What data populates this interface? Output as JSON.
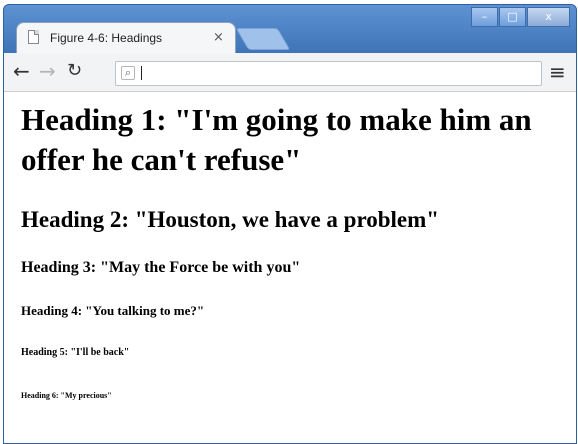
{
  "browser": {
    "tab_title": "Figure 4-6: Headings",
    "tab_close": "×",
    "address_value": "",
    "menu_glyph": "≡",
    "window_controls": [
      "–",
      "□",
      "x"
    ]
  },
  "content": {
    "h1": "Heading 1: \"I'm going to make him an offer he can't refuse\"",
    "h2": "Heading 2: \"Houston, we have a problem\"",
    "h3": "Heading 3: \"May the Force be with you\"",
    "h4": "Heading 4: \"You talking to me?\"",
    "h5": "Heading 5: \"I'll be back\"",
    "h6": "Heading 6: \"My precious\""
  },
  "icons": {
    "back": "back-arrow-icon",
    "forward": "forward-arrow-icon",
    "reload": "reload-icon",
    "search": "search-icon",
    "menu": "menu-icon",
    "page": "page-icon"
  },
  "colors": {
    "titlebar": "#4f86c8",
    "tab": "#f4f6f8",
    "toolbar": "#f2f3f5",
    "content": "#ffffff"
  }
}
